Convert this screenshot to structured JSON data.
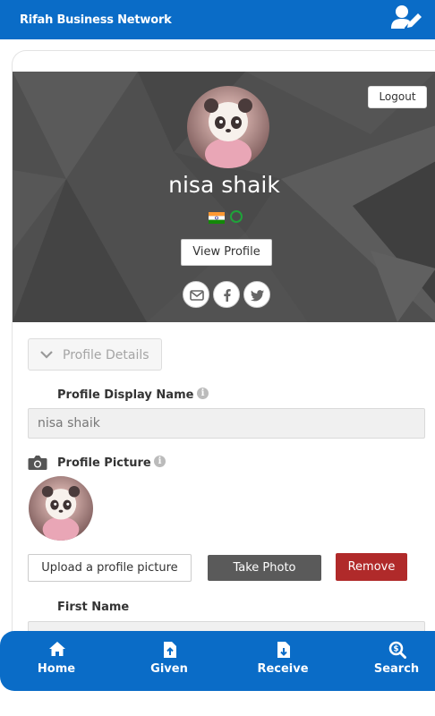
{
  "header": {
    "app_title": "Rifah Business Network"
  },
  "hero": {
    "logout_label": "Logout",
    "user_name": "nisa shaik",
    "view_profile_label": "View Profile",
    "online_status_color": "#1fa33a"
  },
  "profile_section": {
    "accordion_label": "Profile Details",
    "display_name_label": "Profile Display Name",
    "display_name_value": "nisa shaik",
    "picture_label": "Profile Picture",
    "upload_label": "Upload a profile picture",
    "take_photo_label": "Take Photo",
    "remove_label": "Remove",
    "first_name_label": "First Name"
  },
  "bottom_nav": {
    "items": [
      {
        "label": "Home",
        "icon": "home-icon"
      },
      {
        "label": "Given",
        "icon": "file-upload-icon"
      },
      {
        "label": "Receive",
        "icon": "file-download-icon"
      },
      {
        "label": "Search",
        "icon": "search-dollar-icon"
      }
    ]
  },
  "colors": {
    "brand": "#0a6cc7",
    "remove": "#b02a2a",
    "take_photo": "#5a5a5a",
    "hero_bg": "#4f4f4f"
  }
}
